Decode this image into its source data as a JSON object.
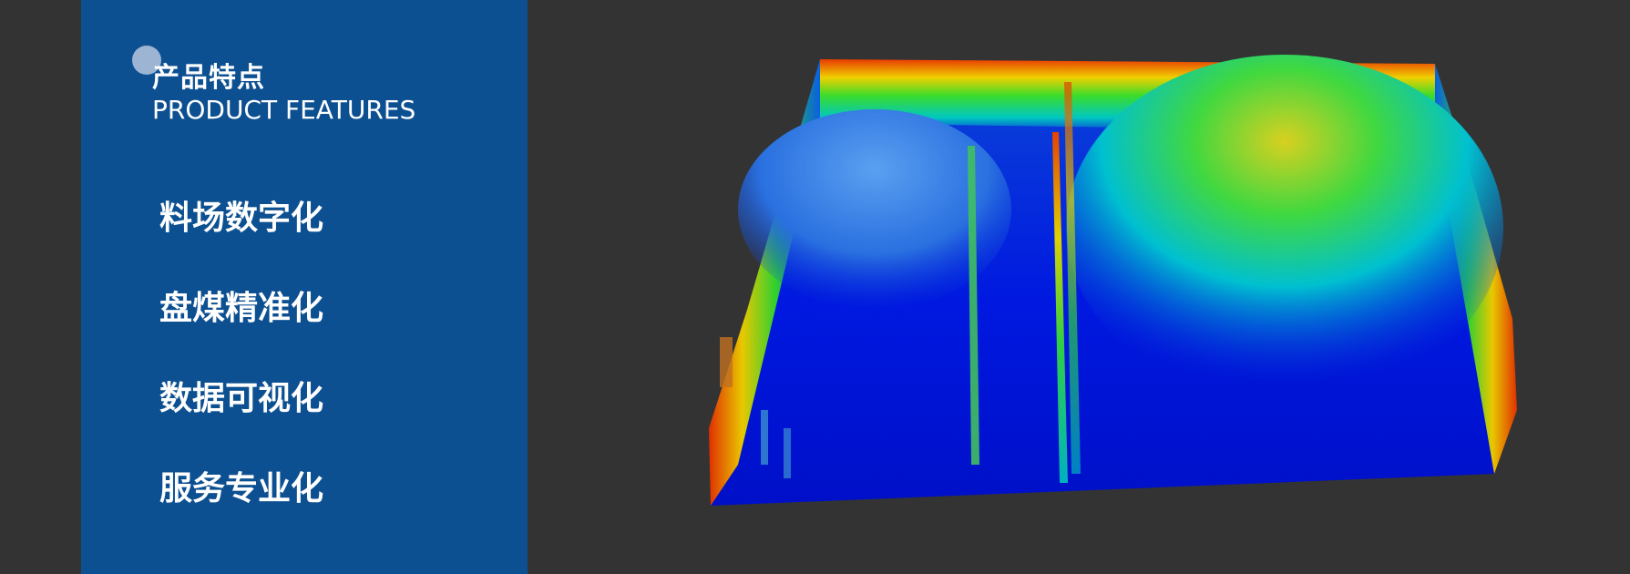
{
  "header": {
    "title_zh": "产品特点",
    "title_en": "PRODUCT FEATURES"
  },
  "features": [
    {
      "label": "料场数字化"
    },
    {
      "label": "盘煤精准化"
    },
    {
      "label": "数据可视化"
    },
    {
      "label": "服务专业化"
    }
  ],
  "colors": {
    "panel": "#0d5092",
    "background": "#333333",
    "scan_low": "#0011dd",
    "scan_high": "#ee2200"
  },
  "image": {
    "subject": "3D point-cloud scan of coal yard"
  }
}
